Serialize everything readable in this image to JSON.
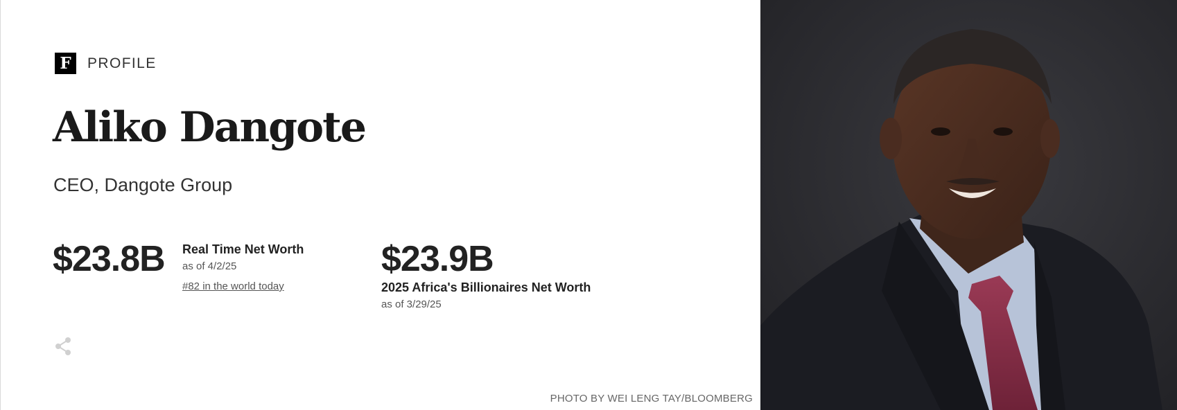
{
  "header": {
    "logo_letter": "F",
    "section_label": "PROFILE"
  },
  "profile": {
    "name": "Aliko Dangote",
    "role": "CEO, Dangote Group"
  },
  "net_worth": {
    "real_time": {
      "value": "$23.8B",
      "label": "Real Time Net Worth",
      "as_of": "as of 4/2/25",
      "rank_link": "#82 in the world today"
    },
    "list": {
      "value": "$23.9B",
      "label": "2025 Africa's Billionaires Net Worth",
      "as_of": "as of 3/29/25"
    }
  },
  "photo": {
    "credit": "PHOTO BY WEI LENG TAY/BLOOMBERG"
  },
  "icons": {
    "share": "share-icon",
    "logo": "forbes-logo"
  },
  "colors": {
    "text_primary": "#222222",
    "text_muted": "#555555",
    "photo_background": "#2b2b2f"
  }
}
